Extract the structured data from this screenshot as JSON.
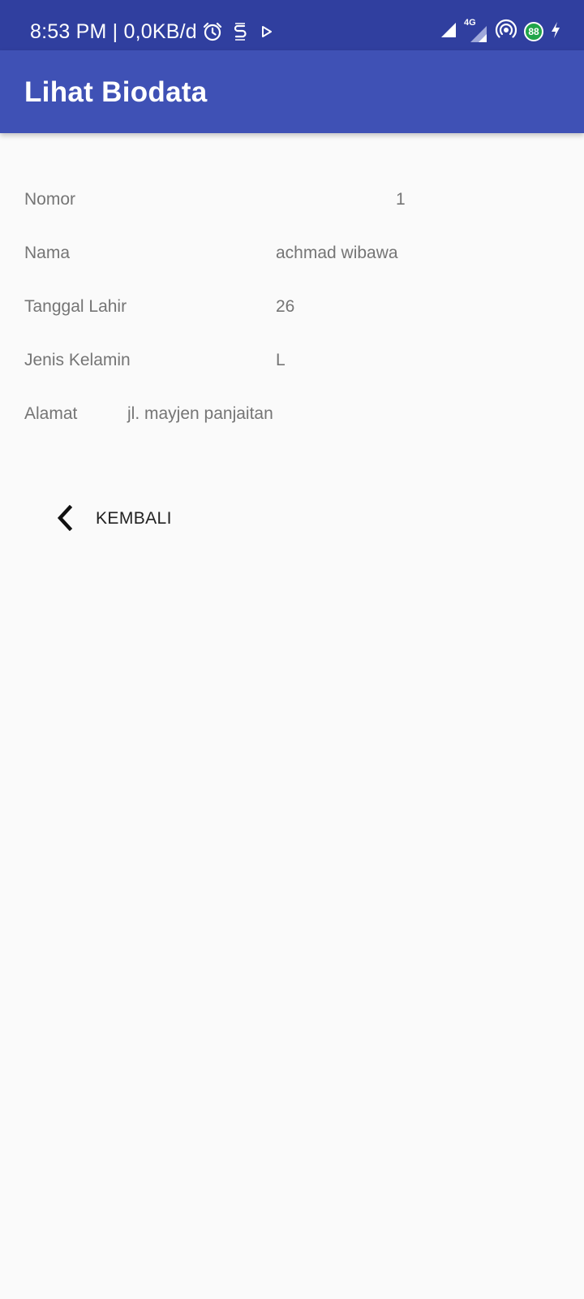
{
  "status_bar": {
    "time_data": "8:53 PM | 0,0KB/d",
    "network": "4G",
    "battery": "88",
    "icons": [
      "alarm-icon",
      "s-app-icon",
      "play-icon",
      "signal-icon",
      "signal-4g-icon",
      "hotspot-icon",
      "battery-icon",
      "charging-icon"
    ],
    "background": "#303f9f"
  },
  "app_bar": {
    "title": "Lihat Biodata",
    "background": "#3f51b5"
  },
  "biodata": {
    "nomor": {
      "label": "Nomor",
      "value": "1"
    },
    "nama": {
      "label": "Nama",
      "value": "achmad wibawa"
    },
    "tanggal_lahir": {
      "label": "Tanggal Lahir",
      "value": "26"
    },
    "jenis_kelamin": {
      "label": "Jenis Kelamin",
      "value": "L"
    },
    "alamat": {
      "label": "Alamat",
      "value": "jl. mayjen panjaitan"
    }
  },
  "back_button": {
    "label": "KEMBALI",
    "icon": "chevron-left-icon"
  }
}
